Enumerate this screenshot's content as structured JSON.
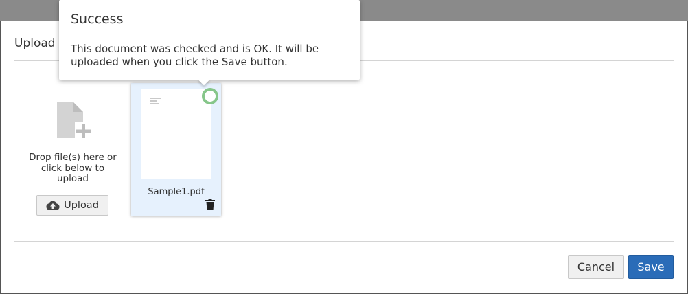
{
  "dialog": {
    "title": "Upload s"
  },
  "drop_zone": {
    "text": "Drop file(s) here or click below to upload",
    "upload_label": "Upload",
    "icon": "file-add-icon"
  },
  "file": {
    "name": "Sample1.pdf",
    "status_icon": "status-ring-icon",
    "delete_icon": "trash-icon",
    "status_color": "#86c68a"
  },
  "tooltip": {
    "title": "Success",
    "body": "This document was checked and is OK. It will be uploaded when you click the Save button."
  },
  "footer": {
    "cancel_label": "Cancel",
    "save_label": "Save"
  },
  "colors": {
    "primary": "#2a6cb8",
    "card_bg": "#e6f1fd",
    "top_bar": "#8a8a8a"
  }
}
